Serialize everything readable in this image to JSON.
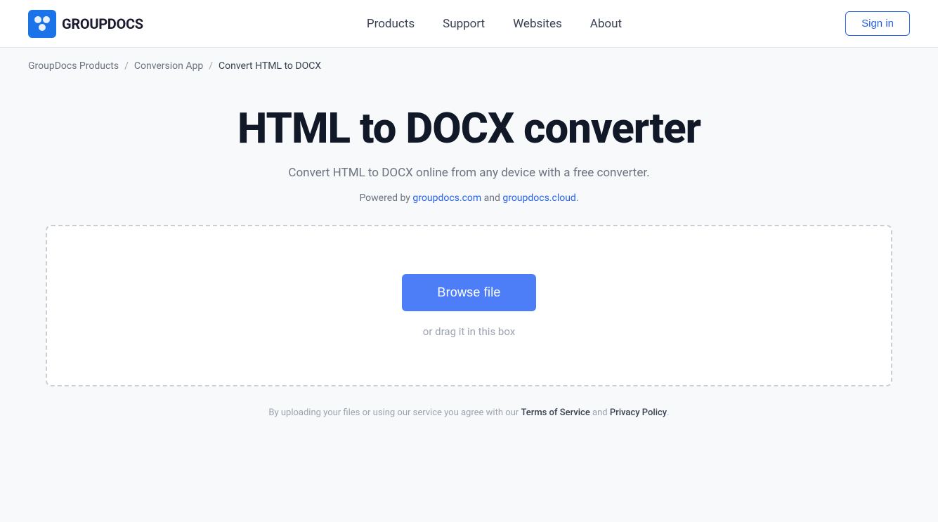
{
  "navbar": {
    "logo_text": "GROUPDOCS",
    "nav_items": [
      {
        "label": "Products",
        "href": "#"
      },
      {
        "label": "Support",
        "href": "#"
      },
      {
        "label": "Websites",
        "href": "#"
      },
      {
        "label": "About",
        "href": "#"
      }
    ],
    "sign_in_label": "Sign in"
  },
  "breadcrumb": {
    "items": [
      {
        "label": "GroupDocs Products",
        "href": "#"
      },
      {
        "label": "Conversion App",
        "href": "#"
      },
      {
        "label": "Convert HTML to DOCX",
        "href": null
      }
    ]
  },
  "hero": {
    "title": "HTML to DOCX converter",
    "subtitle": "Convert HTML to DOCX online from any device with a free converter.",
    "powered_by_prefix": "Powered by ",
    "powered_by_link1_text": "groupdocs.com",
    "powered_by_link1_href": "#",
    "powered_by_and": " and ",
    "powered_by_link2_text": "groupdocs.cloud",
    "powered_by_link2_href": "#",
    "powered_by_suffix": "."
  },
  "drop_zone": {
    "browse_label": "Browse file",
    "drag_text": "or drag it in this box"
  },
  "footer": {
    "prefix": "By uploading your files or using our service you agree with our ",
    "tos_label": "Terms of Service",
    "and": " and ",
    "privacy_label": "Privacy Policy",
    "suffix": "."
  }
}
